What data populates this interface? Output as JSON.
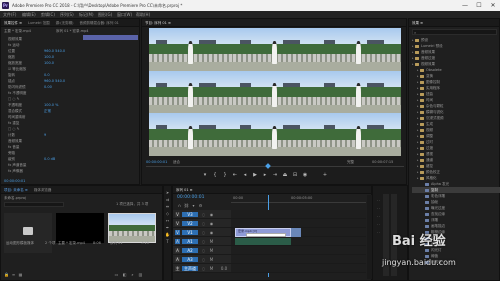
{
  "titlebar": {
    "title": "Adobe Premiere Pro CC 2018 - C:\\用户\\Desktop\\Adobe Premiere Pro CC\\未命名.prproj *",
    "min": "—",
    "max": "☐",
    "close": "✕"
  },
  "menubar": [
    "文件(F)",
    "编辑(E)",
    "剪辑(C)",
    "序列(S)",
    "标记(M)",
    "图形(G)",
    "窗口(W)",
    "帮助(H)"
  ],
  "effect_controls": {
    "tabs": [
      "效果控件 ≡",
      "Lumetri 范围",
      "源:(无剪辑)",
      "音频剪辑混合器: 序列 01"
    ],
    "clip": "主要 * 宏录.mp4",
    "seq": "序列 01 * 宏录.mp4",
    "rows": [
      {
        "label": "视频效果",
        "value": ""
      },
      {
        "label": "fx 运动",
        "value": ""
      },
      {
        "label": "位置",
        "value": "960.0   540.0"
      },
      {
        "label": "缩放",
        "value": "100.0"
      },
      {
        "label": "缩放宽度",
        "value": "100.0"
      },
      {
        "label": "☑ 等比缩放",
        "value": ""
      },
      {
        "label": "旋转",
        "value": "0.0"
      },
      {
        "label": "锚点",
        "value": "960.0   540.0"
      },
      {
        "label": "防闪烁滤镜",
        "value": "0.00"
      },
      {
        "label": "fx 不透明度",
        "value": ""
      },
      {
        "label": "□ ○ ✎",
        "value": ""
      },
      {
        "label": "不透明度",
        "value": "100.0 %"
      },
      {
        "label": "混合模式",
        "value": "正常"
      },
      {
        "label": "时间重映射",
        "value": ""
      },
      {
        "label": "fx 重复",
        "value": ""
      },
      {
        "label": "□ ○ ✎",
        "value": ""
      },
      {
        "label": "计数",
        "value": "9"
      },
      {
        "label": "音频效果",
        "value": ""
      },
      {
        "label": "fx 音量",
        "value": ""
      },
      {
        "label": "旁路",
        "value": ""
      },
      {
        "label": "级别",
        "value": "0.0 dB"
      },
      {
        "label": "fx 声道音量",
        "value": ""
      },
      {
        "label": "fx 声像器",
        "value": ""
      }
    ],
    "timecode": "00:00:00:01"
  },
  "program": {
    "tab": "节目: 序列 01 ≡",
    "timecode_left": "00:00:00:01",
    "fit": "适合",
    "ratio": "完整",
    "timecode_right": "00:00:07:15"
  },
  "project": {
    "tabs": [
      "项目: 未命名 ≡",
      "媒体浏览器"
    ],
    "name": "未命名.prproj",
    "count": "1 项已选择，共 3 项",
    "items": [
      {
        "name": "运动图形模板媒体",
        "meta": "2 个项"
      },
      {
        "name": "主要 * 宏录.mp4",
        "meta": "8:06"
      },
      {
        "name": "序列 01",
        "meta": "7:15"
      }
    ]
  },
  "timeline": {
    "tab": "序列 01 ≡",
    "timecode": "00:00:00:01",
    "ruler": [
      "00:00",
      "00:00:05:00"
    ],
    "tracks": [
      "V3",
      "V2",
      "V1",
      "A1",
      "A2",
      "A3",
      "主声道"
    ],
    "master_value": "0.0",
    "clip_label": "宏录.mp4 [V]"
  },
  "effects": {
    "tabs": [
      "效果 ≡"
    ],
    "search_placeholder": "",
    "items": [
      {
        "label": "预设",
        "indent": 0,
        "folder": true
      },
      {
        "label": "Lumetri 预设",
        "indent": 0,
        "folder": true
      },
      {
        "label": "音频效果",
        "indent": 0,
        "folder": true
      },
      {
        "label": "音频过渡",
        "indent": 0,
        "folder": true
      },
      {
        "label": "视频效果",
        "indent": 0,
        "folder": true
      },
      {
        "label": "Obsolete",
        "indent": 1,
        "folder": true
      },
      {
        "label": "变换",
        "indent": 1,
        "folder": true
      },
      {
        "label": "图像控制",
        "indent": 1,
        "folder": true
      },
      {
        "label": "实用程序",
        "indent": 1,
        "folder": true
      },
      {
        "label": "扭曲",
        "indent": 1,
        "folder": true
      },
      {
        "label": "时间",
        "indent": 1,
        "folder": true
      },
      {
        "label": "杂色与颗粒",
        "indent": 1,
        "folder": true
      },
      {
        "label": "模糊与锐化",
        "indent": 1,
        "folder": true
      },
      {
        "label": "沉浸式视频",
        "indent": 1,
        "folder": true
      },
      {
        "label": "生成",
        "indent": 1,
        "folder": true
      },
      {
        "label": "视频",
        "indent": 1,
        "folder": true
      },
      {
        "label": "调整",
        "indent": 1,
        "folder": true
      },
      {
        "label": "过时",
        "indent": 1,
        "folder": true
      },
      {
        "label": "过渡",
        "indent": 1,
        "folder": true
      },
      {
        "label": "透视",
        "indent": 1,
        "folder": true
      },
      {
        "label": "通道",
        "indent": 1,
        "folder": true
      },
      {
        "label": "键控",
        "indent": 1,
        "folder": true
      },
      {
        "label": "颜色校正",
        "indent": 1,
        "folder": true
      },
      {
        "label": "风格化",
        "indent": 1,
        "folder": true
      },
      {
        "label": "Alpha 发光",
        "indent": 2,
        "folder": false
      },
      {
        "label": "复制",
        "indent": 2,
        "folder": false,
        "selected": true
      },
      {
        "label": "彩色浮雕",
        "indent": 2,
        "folder": false
      },
      {
        "label": "抽帧",
        "indent": 2,
        "folder": false
      },
      {
        "label": "曝光过度",
        "indent": 2,
        "folder": false
      },
      {
        "label": "查找边缘",
        "indent": 2,
        "folder": false
      },
      {
        "label": "浮雕",
        "indent": 2,
        "folder": false
      },
      {
        "label": "画笔描边",
        "indent": 2,
        "folder": false
      },
      {
        "label": "粗糙边缘",
        "indent": 2,
        "folder": false
      },
      {
        "label": "纹理化",
        "indent": 2,
        "folder": false
      },
      {
        "label": "色调分离",
        "indent": 2,
        "folder": false
      },
      {
        "label": "闪光灯",
        "indent": 2,
        "folder": false
      },
      {
        "label": "阈值",
        "indent": 2,
        "folder": false
      },
      {
        "label": "马赛克",
        "indent": 2,
        "folder": false
      }
    ]
  },
  "watermark": {
    "brand": "Bai 经验",
    "url": "jingyan.baidu.com"
  },
  "colors": {
    "accent": "#2d8ceb",
    "playhead": "#4a9fe6",
    "clip": "#8f9bd6"
  }
}
